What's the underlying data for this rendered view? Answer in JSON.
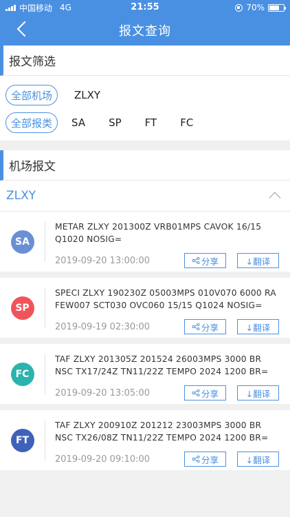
{
  "status": {
    "carrier": "中国移动",
    "network": "4G",
    "time": "21:55",
    "battery": "70%",
    "battery_level": 0.7
  },
  "nav": {
    "title": "报文查询"
  },
  "filter_section": {
    "title": "报文筛选"
  },
  "filters": {
    "airport_chip": "全部机场",
    "airports": [
      "ZLXY"
    ],
    "type_chip": "全部报类",
    "types": [
      "SA",
      "SP",
      "FT",
      "FC"
    ]
  },
  "reports_section": {
    "title": "机场报文"
  },
  "group": {
    "name": "ZLXY"
  },
  "buttons": {
    "share": "分享",
    "translate": "↓翻译"
  },
  "reports": [
    {
      "type": "SA",
      "color": "#6a8fd4",
      "line1": "METAR ZLXY 201300Z VRB01MPS CAVOK 16/15",
      "line2": "Q1020 NOSIG=",
      "time": "2019-09-20 13:00:00"
    },
    {
      "type": "SP",
      "color": "#f0545a",
      "line1": "SPECI ZLXY 190230Z 05003MPS 010V070 6000 RA",
      "line2": "FEW007 SCT030 OVC060 15/15 Q1024 NOSIG=",
      "time": "2019-09-19 02:30:00"
    },
    {
      "type": "FC",
      "color": "#2bb3ad",
      "line1": "TAF ZLXY 201305Z 201524 26003MPS 3000 BR",
      "line2": "NSC TX17/24Z TN11/22Z TEMPO 2024 1200 BR=",
      "time": "2019-09-20 13:05:00"
    },
    {
      "type": "FT",
      "color": "#3f62b8",
      "line1": "TAF ZLXY 200910Z 201212 23003MPS 3000 BR",
      "line2": "NSC TX26/08Z TN11/22Z TEMPO 2024 1200 BR=",
      "time": "2019-09-20 09:10:00"
    }
  ]
}
